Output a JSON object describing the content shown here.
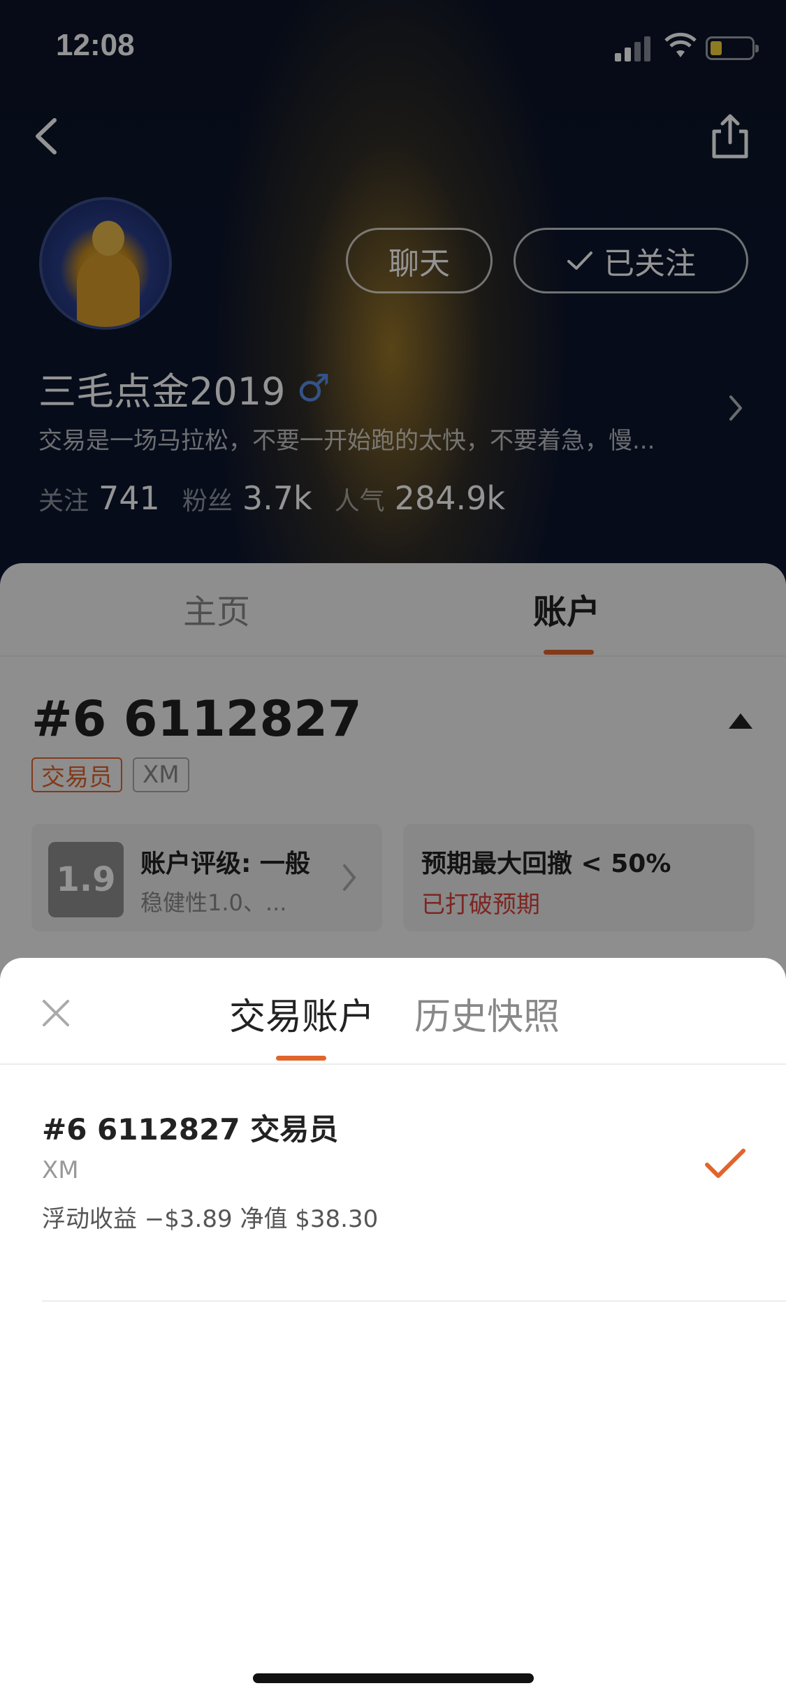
{
  "status_bar": {
    "time": "12:08"
  },
  "profile": {
    "username": "三毛点金2019",
    "gender_symbol": "♂",
    "bio": "交易是一场马拉松，不要一开始跑的太快，不要着急，慢...",
    "chat_label": "聊天",
    "follow_label": "已关注",
    "stats": [
      {
        "label": "关注",
        "value": "741"
      },
      {
        "label": "粉丝",
        "value": "3.7k"
      },
      {
        "label": "人气",
        "value": "284.9k"
      }
    ]
  },
  "main_tabs": {
    "home": "主页",
    "account": "账户",
    "active": "account"
  },
  "account": {
    "title": "#6 6112827",
    "badge_role": "交易员",
    "badge_broker": "XM",
    "rating_score": "1.9",
    "rating_title": "账户评级: 一般",
    "rating_sub": "稳健性1.0、...",
    "drawdown_title": "预期最大回撤 < 50%",
    "drawdown_status": "已打破预期"
  },
  "sheet": {
    "tabs": [
      "交易账户",
      "历史快照"
    ],
    "active_tab": 0,
    "items": [
      {
        "title": "#6 6112827 交易员",
        "broker": "XM",
        "stats": "浮动收益 −$3.89   净值 $38.30",
        "selected": true
      }
    ]
  },
  "colors": {
    "accent": "#e0652b",
    "danger": "#d6433b",
    "header_bg": "#0b1428"
  },
  "icons": [
    "back-icon",
    "share-icon",
    "check-icon",
    "chevron-right-icon",
    "caret-up-icon",
    "close-icon",
    "checkmark-selected-icon"
  ]
}
